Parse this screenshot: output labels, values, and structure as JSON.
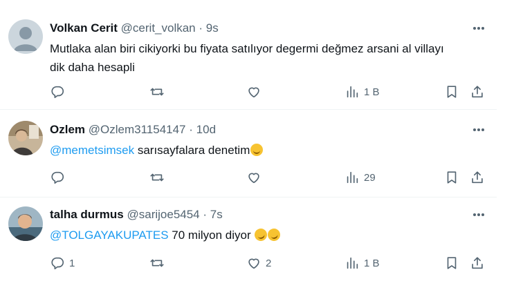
{
  "tweets": [
    {
      "name": "Volkan Cerit",
      "handle": "@cerit_volkan",
      "dot": "·",
      "time": "9s",
      "text_line1": "Mutlaka alan biri cikiyorki bu fiyata satılıyor degermi değmez arsani al villayı",
      "text_line2": "dik daha hesapli",
      "replies": "",
      "retweets": "",
      "likes": "",
      "views": "1 B"
    },
    {
      "name": "Ozlem",
      "handle": "@Ozlem31154147",
      "dot": "·",
      "time": "10d",
      "mention": "@memetsimsek",
      "text": " sarısayfalara denetim",
      "emoji": "smirk",
      "replies": "",
      "retweets": "",
      "likes": "",
      "views": "29"
    },
    {
      "name": "talha durmus",
      "handle": "@sarijoe5454",
      "dot": "·",
      "time": "7s",
      "mention": "@TOLGAYAKUPATES",
      "text": " 70 milyon diyor ",
      "emoji": "rolling-laughing",
      "replies": "1",
      "retweets": "",
      "likes": "2",
      "views": "1 B"
    }
  ],
  "colors": {
    "text": "#0f1419",
    "secondary": "#536471",
    "link": "#1d9bf0",
    "divider": "#eff3f4"
  }
}
